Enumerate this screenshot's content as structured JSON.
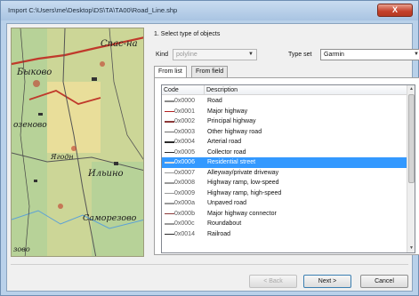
{
  "window": {
    "title": "Import C:\\Users\\me\\Desktop\\DS\\TA\\TA00\\Road_Line.shp",
    "close_glyph": "X"
  },
  "map": {
    "labels": [
      "Спас-на",
      "Быково",
      "озеново",
      "Ильино",
      "Саморезово",
      "Ягодн",
      "зово"
    ]
  },
  "panel": {
    "step_title": "1. Select type of objects",
    "kind_label": "Kind",
    "kind_value": "polyline",
    "type_set_label": "Type set",
    "type_set_value": "Garmin",
    "tabs": [
      "From list",
      "From field"
    ]
  },
  "list": {
    "headers": {
      "code": "Code",
      "description": "Description"
    },
    "rows": [
      {
        "code": "0x0000",
        "description": "Road",
        "color": "#8a8a8a"
      },
      {
        "code": "0x0001",
        "description": "Major highway",
        "color": "#b22222"
      },
      {
        "code": "0x0002",
        "description": "Principal highway",
        "color": "#8b3a3a"
      },
      {
        "code": "0x0003",
        "description": "Other highway road",
        "color": "#6e6e6e"
      },
      {
        "code": "0x0004",
        "description": "Arterial road",
        "color": "#2b2b2b"
      },
      {
        "code": "0x0005",
        "description": "Collector road",
        "color": "#2b2b2b"
      },
      {
        "code": "0x0006",
        "description": "Residential street",
        "color": "#dddddd"
      },
      {
        "code": "0x0007",
        "description": "Alleyway/private driveway",
        "color": "#9a9a9a"
      },
      {
        "code": "0x0008",
        "description": "Highway ramp, low-speed",
        "color": "#9a9a9a"
      },
      {
        "code": "0x0009",
        "description": "Highway ramp, high-speed",
        "color": "#9a9a9a"
      },
      {
        "code": "0x000a",
        "description": "Unpaved road",
        "color": "#9a9a9a"
      },
      {
        "code": "0x000b",
        "description": "Major highway connector",
        "color": "#8b3a3a"
      },
      {
        "code": "0x000c",
        "description": "Roundabout",
        "color": "#9a9a9a"
      },
      {
        "code": "0x0014",
        "description": "Railroad",
        "color": "#2b2b2b"
      }
    ],
    "selected_index": 6
  },
  "buttons": {
    "back": "< Back",
    "next": "Next >",
    "cancel": "Cancel"
  },
  "colors": {
    "selection": "#3399ff",
    "map_background": "#e9dc96",
    "forest": "#a9cf9a"
  }
}
